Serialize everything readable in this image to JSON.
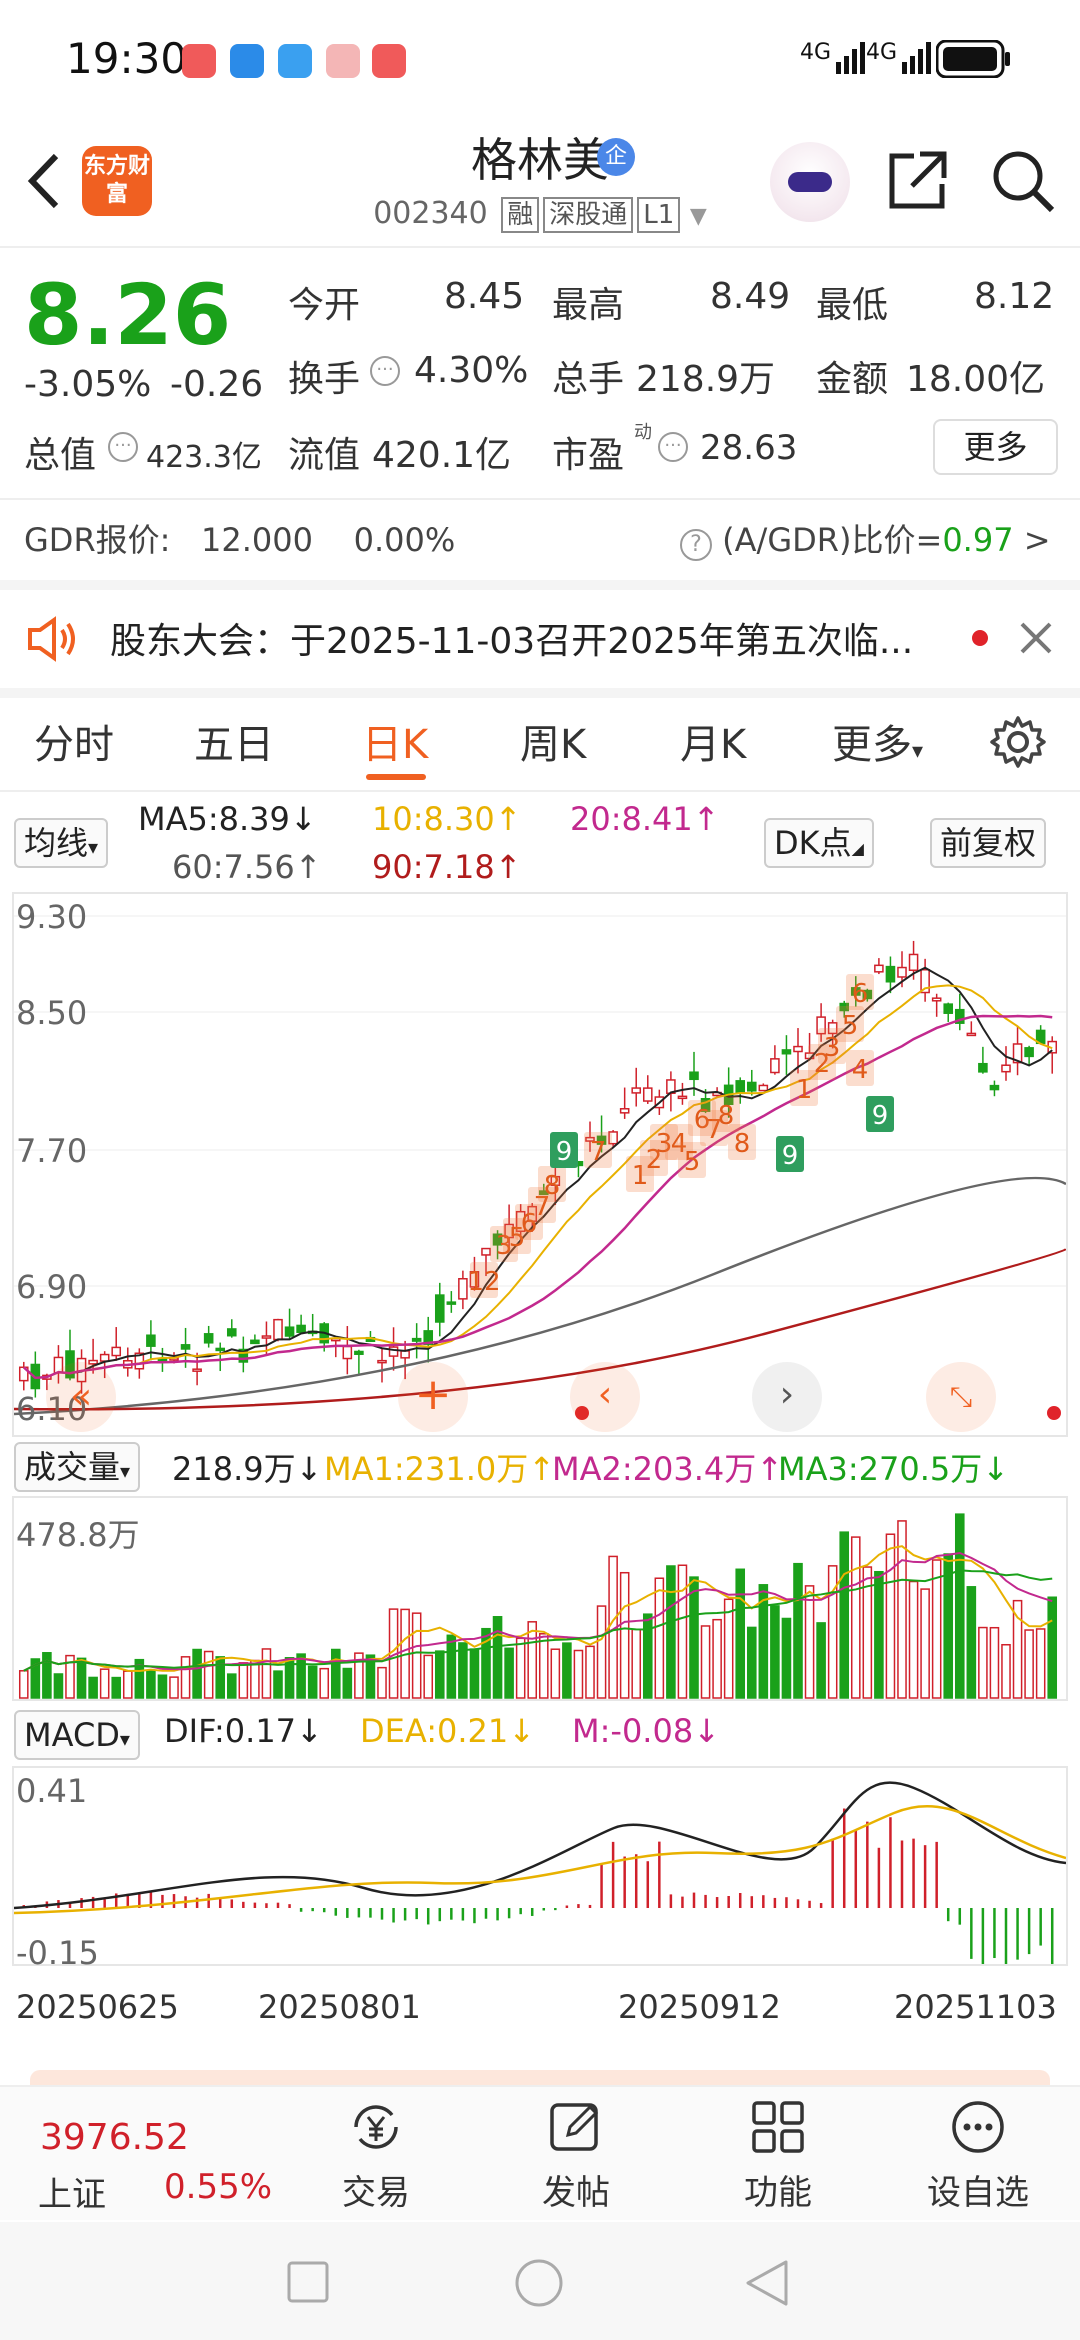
{
  "status": {
    "time": "19:30",
    "net1": "4G",
    "net2": "4G"
  },
  "header": {
    "brand": "东方财富",
    "name": "格林美",
    "qi": "企",
    "code": "002340",
    "tags": [
      "融",
      "深股通",
      "L1"
    ]
  },
  "quote": {
    "price": "8.26",
    "pct": "-3.05%",
    "chg": "-0.26",
    "open_label": "今开",
    "open": "8.45",
    "high_label": "最高",
    "high": "8.49",
    "low_label": "最低",
    "low": "8.12",
    "turnover_label": "换手",
    "turnover": "4.30%",
    "volume_label": "总手",
    "volume": "218.9万",
    "amount_label": "金额",
    "amount": "18.00亿",
    "mktcap_label": "总值",
    "mktcap": "423.3亿",
    "float_label": "流值",
    "float": "420.1亿",
    "pe_label": "市盈",
    "pe_sup": "动",
    "pe": "28.63",
    "more": "更多"
  },
  "gdr": {
    "label": "GDR报价:",
    "price": "12.000",
    "pct": "0.00%",
    "ratio_label": "(A/GDR)比价=",
    "ratio": "0.97",
    "arrow": ">"
  },
  "notice": {
    "text": "股东大会：于2025-11-03召开2025年第五次临..."
  },
  "tabs": [
    "分时",
    "五日",
    "日K",
    "周K",
    "月K",
    "更多"
  ],
  "active_tab": "日K",
  "ma_legend": {
    "selector": "均线",
    "ma5": "MA5:8.39",
    "ma10": "10:8.30",
    "ma20": "20:8.41",
    "ma60": "60:7.56",
    "ma90": "90:7.18",
    "dk": "DK点",
    "adjust": "前复权"
  },
  "price_axis": [
    "9.30",
    "8.50",
    "7.70",
    "6.90"
  ],
  "price_axis_low": "6.10",
  "kline_markers": [
    "12",
    "3",
    "5",
    "6",
    "7",
    "8",
    "9",
    "1",
    "2",
    "3",
    "4",
    "5",
    "6",
    "7",
    "8",
    "9",
    "1",
    "2",
    "3",
    "4",
    "5",
    "6",
    "7",
    "8",
    "9"
  ],
  "volume_legend": {
    "selector": "成交量",
    "vol": "218.9万",
    "ma1": "MA1:231.0万",
    "ma2": "MA2:203.4万",
    "ma3": "MA3:270.5万",
    "axis": "478.8万"
  },
  "macd_legend": {
    "selector": "MACD",
    "dif": "DIF:0.17",
    "dea": "DEA:0.21",
    "m": "M:-0.08",
    "axis_top": "0.41",
    "axis_bottom": "-0.15"
  },
  "dates": [
    "20250625",
    "20250801",
    "20250912",
    "20251103"
  ],
  "bottom": {
    "index_value": "3976.52",
    "index_name": "上证",
    "index_pct": "0.55%",
    "items": [
      "交易",
      "发帖",
      "功能",
      "设自选"
    ]
  },
  "colors": {
    "up": "#d0202a",
    "down": "#1aa11a",
    "accent": "#f06021"
  }
}
